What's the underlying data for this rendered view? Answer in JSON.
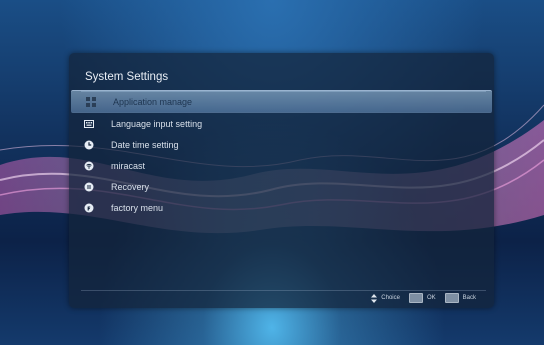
{
  "panel": {
    "title": "System Settings"
  },
  "menu": {
    "items": [
      {
        "label": "Application manage",
        "icon": "apps-grid-icon",
        "selected": true
      },
      {
        "label": "Language input setting",
        "icon": "keyboard-icon",
        "selected": false
      },
      {
        "label": "Date time setting",
        "icon": "clock-icon",
        "selected": false
      },
      {
        "label": "miracast",
        "icon": "miracast-icon",
        "selected": false
      },
      {
        "label": "Recovery",
        "icon": "recovery-icon",
        "selected": false
      },
      {
        "label": "factory menu",
        "icon": "factory-icon",
        "selected": false
      }
    ]
  },
  "hints": {
    "choice": "Choice",
    "ok": "OK",
    "back": "Back"
  },
  "colors": {
    "selected_highlight": "#9ec4e6",
    "panel_bg": "#14243a",
    "text": "#d8e0ea"
  }
}
